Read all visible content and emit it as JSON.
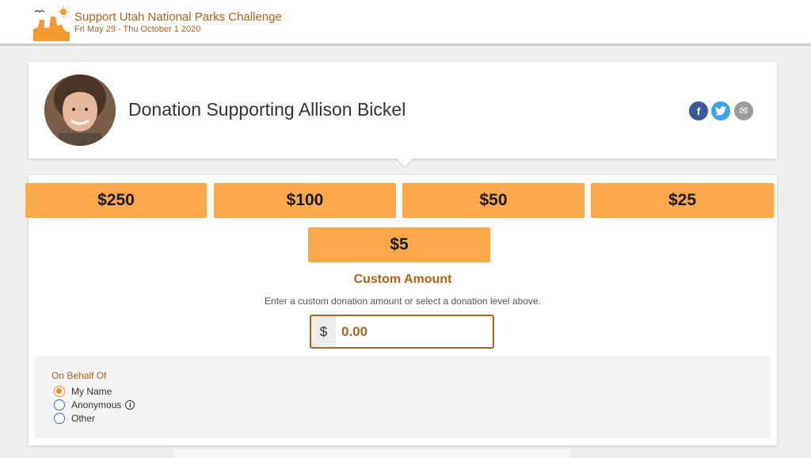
{
  "header": {
    "title": "Support Utah National Parks Challenge",
    "dates": "Fri May 29 - Thu October 1 2020"
  },
  "profile": {
    "heading": "Donation Supporting Allison Bickel"
  },
  "social": {
    "facebook": "f",
    "twitter": "t",
    "email": "✉"
  },
  "amounts": [
    "$250",
    "$100",
    "$50",
    "$25",
    "$5"
  ],
  "custom": {
    "title": "Custom Amount",
    "hint": "Enter a custom donation amount or select a donation level above.",
    "currency": "$",
    "value": "0.00"
  },
  "behalf": {
    "label": "On Behalf Of",
    "options": [
      "My Name",
      "Anonymous",
      "Other"
    ],
    "selected": "My Name"
  },
  "colors": {
    "accent": "#fca94c",
    "brand": "#b0621a"
  }
}
